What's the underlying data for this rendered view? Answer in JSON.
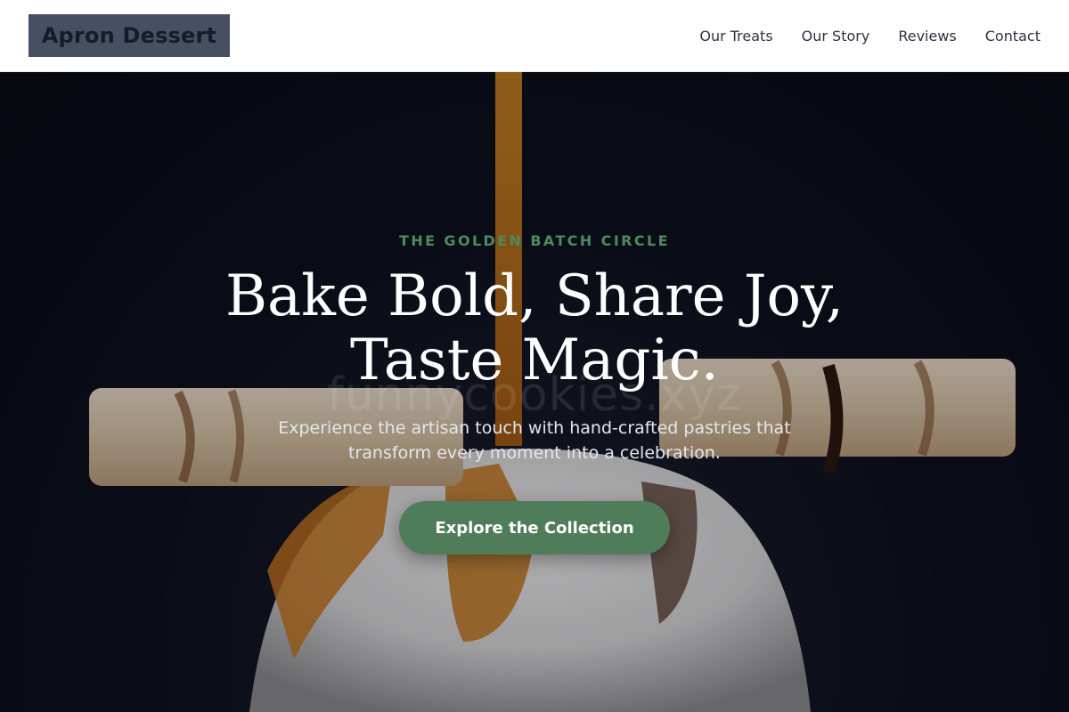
{
  "header": {
    "logo": "Apron Dessert",
    "nav": [
      "Our Treats",
      "Our Story",
      "Reviews",
      "Contact"
    ]
  },
  "hero": {
    "eyebrow": "THE GOLDEN BATCH CIRCLE",
    "headline_line1": "Bake Bold, Share Joy,",
    "headline_line2": "Taste Magic.",
    "subtext": "Experience the artisan touch with hand-crafted pastries that transform every moment into a celebration.",
    "cta": "Explore the Collection",
    "watermark": "funnycookies.xyz",
    "image_subject": "wafer roll dessert with caramel drizzle"
  },
  "colors": {
    "accent": "#4f7d5a",
    "eyebrow": "#4f8a5e",
    "logo_bg": "#475063",
    "hero_bg": "#0b0d17"
  }
}
